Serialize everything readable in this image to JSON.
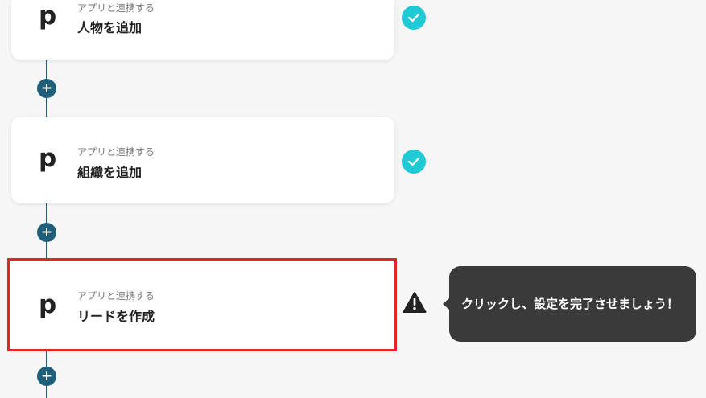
{
  "steps": [
    {
      "subtitle": "アプリと連携する",
      "title": "人物を追加",
      "app_icon": "p",
      "status": "complete",
      "status_icon": "check-icon"
    },
    {
      "subtitle": "アプリと連携する",
      "title": "組織を追加",
      "app_icon": "p",
      "status": "complete",
      "status_icon": "check-icon"
    },
    {
      "subtitle": "アプリと連携する",
      "title": "リードを作成",
      "app_icon": "p",
      "status": "incomplete",
      "status_icon": "warning-icon"
    }
  ],
  "add_step_icon": "plus-icon",
  "tooltip": {
    "text": "クリックし、設定を完了させましょう！"
  },
  "colors": {
    "background": "#f6f6f7",
    "connector": "#1f5f7a",
    "check": "#1fc9d6",
    "selected_border": "#e0262b",
    "tooltip_bg": "#3a3a3a"
  }
}
